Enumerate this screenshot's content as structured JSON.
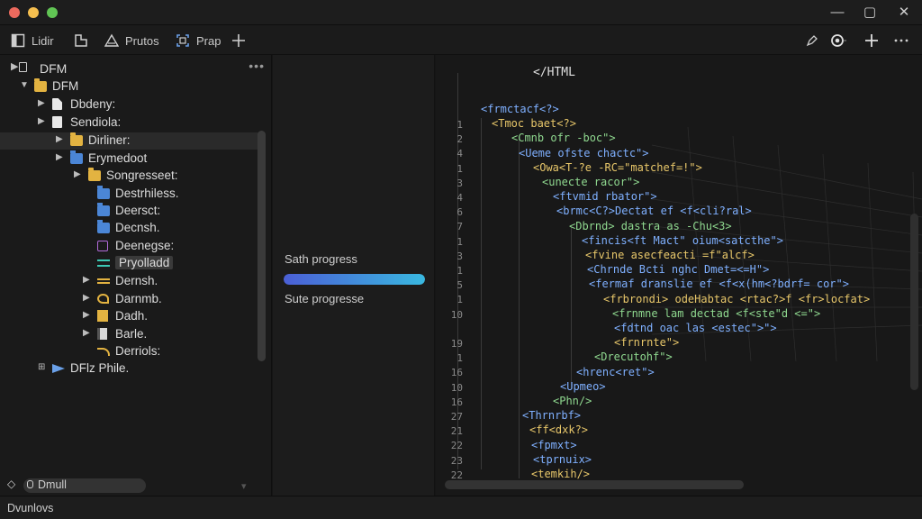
{
  "window": {
    "dots": [
      "#ed6a5e",
      "#f5bf4f",
      "#61c554"
    ],
    "controls": {
      "minimize": "—",
      "maximize": "▢",
      "close": "✕"
    }
  },
  "toolbar": {
    "items": [
      {
        "label": "Lidir",
        "icon": "split-pane-icon"
      },
      {
        "label": "",
        "icon": "layers-icon"
      },
      {
        "label": "Prutos",
        "icon": "warning-triangle-icon"
      },
      {
        "label": "Prap",
        "icon": "frame-icon"
      },
      {
        "label": "",
        "icon": "plus-icon"
      }
    ],
    "right": [
      "pen-icon",
      "record-icon",
      "plus-icon",
      "more-icon"
    ]
  },
  "sidebar": {
    "title": "DFM",
    "more": "•••",
    "tree": [
      {
        "label": "DFM",
        "level": 1,
        "caret": "▼",
        "icon": "folder"
      },
      {
        "label": "Dbdeny:",
        "level": 2,
        "caret": "▶",
        "icon": "file-shape"
      },
      {
        "label": "Sendiola:",
        "level": 2,
        "caret": "▶",
        "icon": "file-white"
      },
      {
        "label": "Dirliner:",
        "level": 3,
        "caret": "▶",
        "icon": "folder"
      },
      {
        "label": "Erymedoot",
        "level": 3,
        "caret": "▶",
        "icon": "folder-blue"
      },
      {
        "label": "Songresseet:",
        "level": 4,
        "caret": "▶",
        "icon": "folder"
      },
      {
        "label": "Destrhiless.",
        "level": 5,
        "caret": "",
        "icon": "folder-blue"
      },
      {
        "label": "Deersct:",
        "level": 5,
        "caret": "",
        "icon": "folder-blue"
      },
      {
        "label": "Decnsh.",
        "level": 5,
        "caret": "",
        "icon": "folder-blue"
      },
      {
        "label": "Deenegse:",
        "level": 5,
        "caret": "",
        "icon": "purple-file"
      },
      {
        "label": "Pryolladd",
        "level": 5,
        "caret": "",
        "icon": "teal-arrow"
      },
      {
        "label": "Dernsh.",
        "level": 5,
        "caret": "▶",
        "icon": "dash-yellow"
      },
      {
        "label": "Darnmb.",
        "level": 5,
        "caret": "▶",
        "icon": "swirl-yellow"
      },
      {
        "label": "Dadh.",
        "level": 5,
        "caret": "▶",
        "icon": "file-yellow"
      },
      {
        "label": "Barle.",
        "level": 5,
        "caret": "▶",
        "icon": "file-dark"
      },
      {
        "label": "Derriols:",
        "level": 5,
        "caret": "",
        "icon": "curve-yellow"
      },
      {
        "label": "DFlz Phile.",
        "level": 2,
        "caret": "⊞",
        "icon": "flag-blue"
      }
    ],
    "bottom_label": "Dmull",
    "bottom_glyph": "◇"
  },
  "middle": {
    "progress_label_1": "Sath progress",
    "progress_label_2": "Sute progresse",
    "progress": 1.0
  },
  "editor": {
    "title": "</HTML",
    "line_numbers": [
      "1",
      "2",
      "4",
      "1",
      "3",
      "4",
      "6",
      "7",
      "1",
      "3",
      "1",
      "5",
      "1",
      "10",
      "",
      "19",
      "1",
      "16",
      "10",
      "16",
      "27",
      "21",
      "22",
      "23",
      "22"
    ],
    "lines": [
      "<frmctacf<?>",
      "<Tmoc baet<?>",
      "<Cmnb ofr -boc\">",
      "<Ueme ofste chactc\">",
      "<Owa<T-?e -RC=\"matchef=!\">",
      "<unecte racor\">",
      "<ftvmid rbator\">",
      "<brmc<C?>Dectat ef <f<cli?ral>",
      "<Dbrnd> dastra as -Chu<3>",
      "<fincis<ft Mact\" oium<satcthe\">",
      "<fvine asecfeacti =f\"alcf>",
      "<Chrnde Bcti nghc Dmet=<=H\">",
      "<fermaf dranslie ef <f<x(hm<?bdrf= cor\">",
      "<frbrondi> odeHabtac <rtac?>f <fr>locfat>",
      "<frnmne lam dectad <f<ste\"d <=\">",
      "<fdtnd oac las <estec\">\">",
      "<frnrnte\">",
      "<Drecutohf\">",
      "<hrenc<ret\">",
      "<Upmeo>",
      "<Phn/>",
      "<Thrnrbf>",
      "<ff<dxk?>",
      "<fpmxt>",
      "<tprnuix>",
      "<temkih/>"
    ]
  },
  "status": {
    "text": "Dvunlovs"
  }
}
